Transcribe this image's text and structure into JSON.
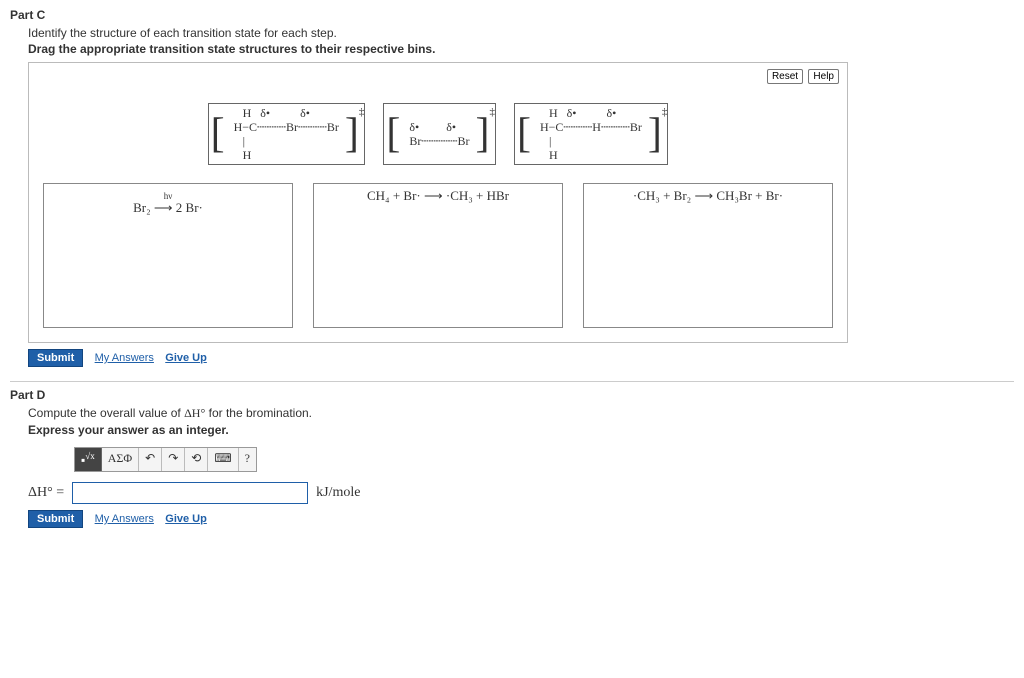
{
  "partC": {
    "header": "Part C",
    "instr1": "Identify the structure of each transition state for each step.",
    "instr2": "Drag the appropriate transition state structures to their respective bins.",
    "reset": "Reset",
    "help": "Help",
    "ts1": "    H   δ•          δ•\n H−C┄┄┄┄Br┄┄┄┄Br\n    |\n    H",
    "ts2": " δ•         δ•\n Br┄┄┄┄┄Br",
    "ts3": "    H   δ•          δ•\n H−C┄┄┄┄H┄┄┄┄Br\n    |\n    H",
    "ddagger": "‡",
    "bins": {
      "b1_line1": "hν",
      "b1_line2": "Br₂  ⟶  2 Br·",
      "b2": "CH₄  +  Br·  ⟶  ·CH₃  +  HBr",
      "b3": "·CH₃  +  Br₂  ⟶  CH₃Br  +  Br·"
    }
  },
  "partD": {
    "header": "Part D",
    "instr1_pre": "Compute the overall value of ",
    "instr1_var": "ΔH°",
    "instr1_post": " for the bromination.",
    "instr2": "Express your answer as an integer.",
    "toolbar": {
      "t1": "√x",
      "t2": "ΑΣΦ",
      "t3": "↶",
      "t4": "↷",
      "t5": "⟲",
      "t6": "⌨",
      "t7": "?"
    },
    "lhs": "ΔH° =",
    "units": "kJ/mole"
  },
  "submit": "Submit",
  "myAnswers": "My Answers",
  "giveUp": "Give Up"
}
